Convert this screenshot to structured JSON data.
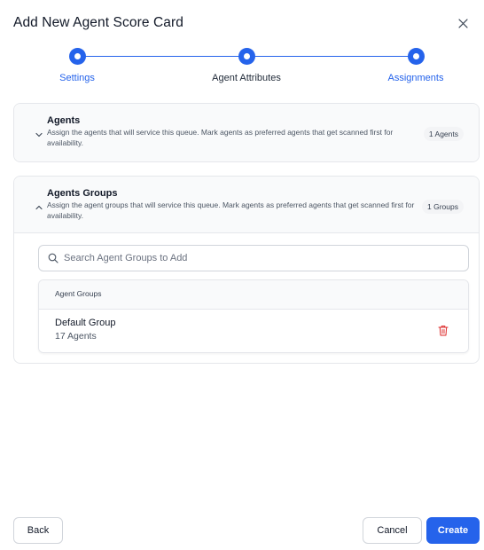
{
  "modal": {
    "title": "Add New Agent Score Card"
  },
  "stepper": {
    "steps": [
      {
        "label": "Settings"
      },
      {
        "label": "Agent Attributes"
      },
      {
        "label": "Assignments"
      }
    ]
  },
  "agents_section": {
    "title": "Agents",
    "description": "Assign the agents that will service this queue. Mark agents as preferred agents that get scanned first for availability.",
    "badge": "1 Agents"
  },
  "groups_section": {
    "title": "Agents Groups",
    "description": "Assign the agent groups that will service this queue. Mark agents as preferred agents that get scanned first for availability.",
    "badge": "1 Groups",
    "search_placeholder": "Search Agent Groups to Add",
    "search_value": "",
    "table_header": "Agent Groups",
    "rows": [
      {
        "name": "Default Group",
        "subtitle": "17 Agents"
      }
    ]
  },
  "footer": {
    "back_label": "Back",
    "cancel_label": "Cancel",
    "create_label": "Create"
  },
  "colors": {
    "accent": "#2563eb",
    "danger": "#dc2626"
  },
  "icons": [
    "close-icon",
    "chevron-down-icon",
    "chevron-up-icon",
    "search-icon",
    "trash-icon"
  ]
}
